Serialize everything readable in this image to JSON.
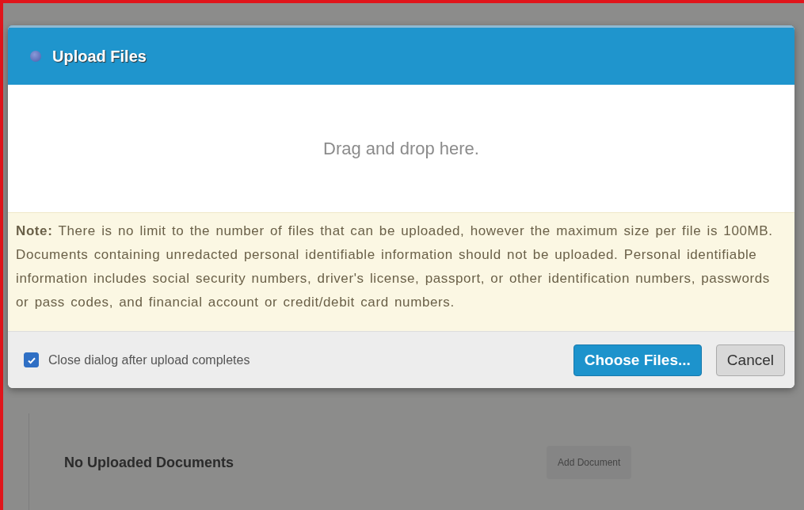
{
  "dialog": {
    "title": "Upload Files",
    "drop_text": "Drag and drop here.",
    "note_label": "Note:",
    "note": "There is no limit to the number of files that can be uploaded, however the maximum size per file is 100MB. Documents containing unredacted personal identifiable information should not be uploaded. Personal identifiable information includes social security numbers, driver's license, passport, or other identification numbers, passwords or pass codes, and financial account or credit/debit card numbers.",
    "close_after_upload": {
      "label": "Close dialog after upload completes",
      "checked": true
    },
    "buttons": [
      {
        "label": "Choose Files...",
        "kind": "primary"
      },
      {
        "label": "Cancel",
        "kind": "secondary"
      }
    ]
  },
  "documents": {
    "empty_text": "No Uploaded Documents",
    "add_button": "Add Document"
  }
}
